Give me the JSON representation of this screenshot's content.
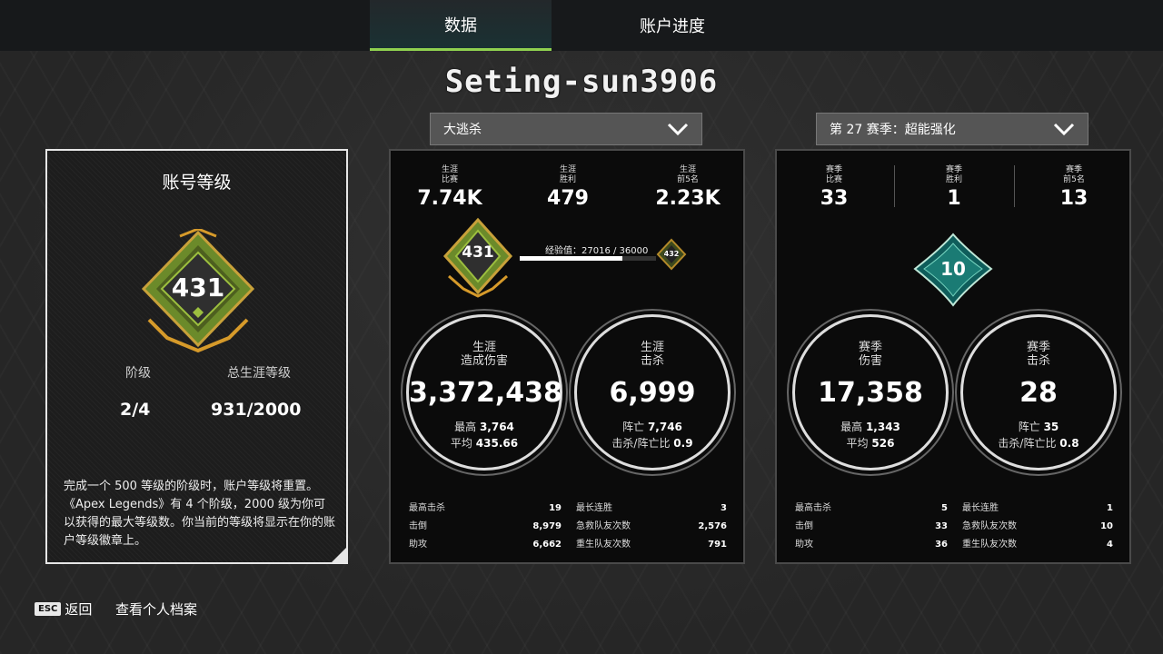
{
  "tabs": [
    {
      "label": "数据",
      "active": true
    },
    {
      "label": "账户进度",
      "active": false
    }
  ],
  "username": "Seting-sun3906",
  "mode_dropdown": {
    "value": "大逃杀"
  },
  "season_dropdown": {
    "value": "第 27 赛季：超能强化"
  },
  "account_level": {
    "title": "账号等级",
    "badge_level": "431",
    "tier_label": "阶级",
    "tier_value": "2/4",
    "total_label": "总生涯等级",
    "total_value": "931/2000",
    "description": "完成一个 500 等级的阶级时，账户等级将重置。《Apex Legends》有 4 个阶级，2000 级为你可以获得的最大等级数。你当前的等级将显示在你的账户等级徽章上。"
  },
  "career": {
    "top_stats": [
      {
        "label": "生涯\n比赛",
        "value": "7.74K"
      },
      {
        "label": "生涯\n胜利",
        "value": "479"
      },
      {
        "label": "生涯\n前5名",
        "value": "2.23K"
      }
    ],
    "current_level": "431",
    "next_level": "432",
    "xp_text": "经验值：27016 / 36000",
    "xp_progress": 0.75,
    "damage": {
      "label": "生涯\n造成伤害",
      "value": "3,372,438",
      "line1_label": "最高",
      "line1_value": "3,764",
      "line2_label": "平均",
      "line2_value": "435.66"
    },
    "kills": {
      "label": "生涯\n击杀",
      "value": "6,999",
      "line1_label": "阵亡",
      "line1_value": "7,746",
      "line2_label": "击杀/阵亡比",
      "line2_value": "0.9"
    },
    "table_left": [
      {
        "label": "最高击杀",
        "value": "19"
      },
      {
        "label": "击倒",
        "value": "8,979"
      },
      {
        "label": "助攻",
        "value": "6,662"
      }
    ],
    "table_right": [
      {
        "label": "最长连胜",
        "value": "3"
      },
      {
        "label": "急救队友次数",
        "value": "2,576"
      },
      {
        "label": "重生队友次数",
        "value": "791"
      }
    ]
  },
  "season": {
    "top_stats": [
      {
        "label": "赛季\n比赛",
        "value": "33"
      },
      {
        "label": "赛季\n胜利",
        "value": "1"
      },
      {
        "label": "赛季\n前5名",
        "value": "13"
      }
    ],
    "badge_level": "10",
    "damage": {
      "label": "赛季\n伤害",
      "value": "17,358",
      "line1_label": "最高",
      "line1_value": "1,343",
      "line2_label": "平均",
      "line2_value": "526"
    },
    "kills": {
      "label": "赛季\n击杀",
      "value": "28",
      "line1_label": "阵亡",
      "line1_value": "35",
      "line2_label": "击杀/阵亡比",
      "line2_value": "0.8"
    },
    "table_left": [
      {
        "label": "最高击杀",
        "value": "5"
      },
      {
        "label": "击倒",
        "value": "33"
      },
      {
        "label": "助攻",
        "value": "36"
      }
    ],
    "table_right": [
      {
        "label": "最长连胜",
        "value": "1"
      },
      {
        "label": "急救队友次数",
        "value": "10"
      },
      {
        "label": "重生队友次数",
        "value": "4"
      }
    ]
  },
  "footer": {
    "esc_key": "ESC",
    "back_label": "返回",
    "profile_label": "查看个人档案"
  }
}
